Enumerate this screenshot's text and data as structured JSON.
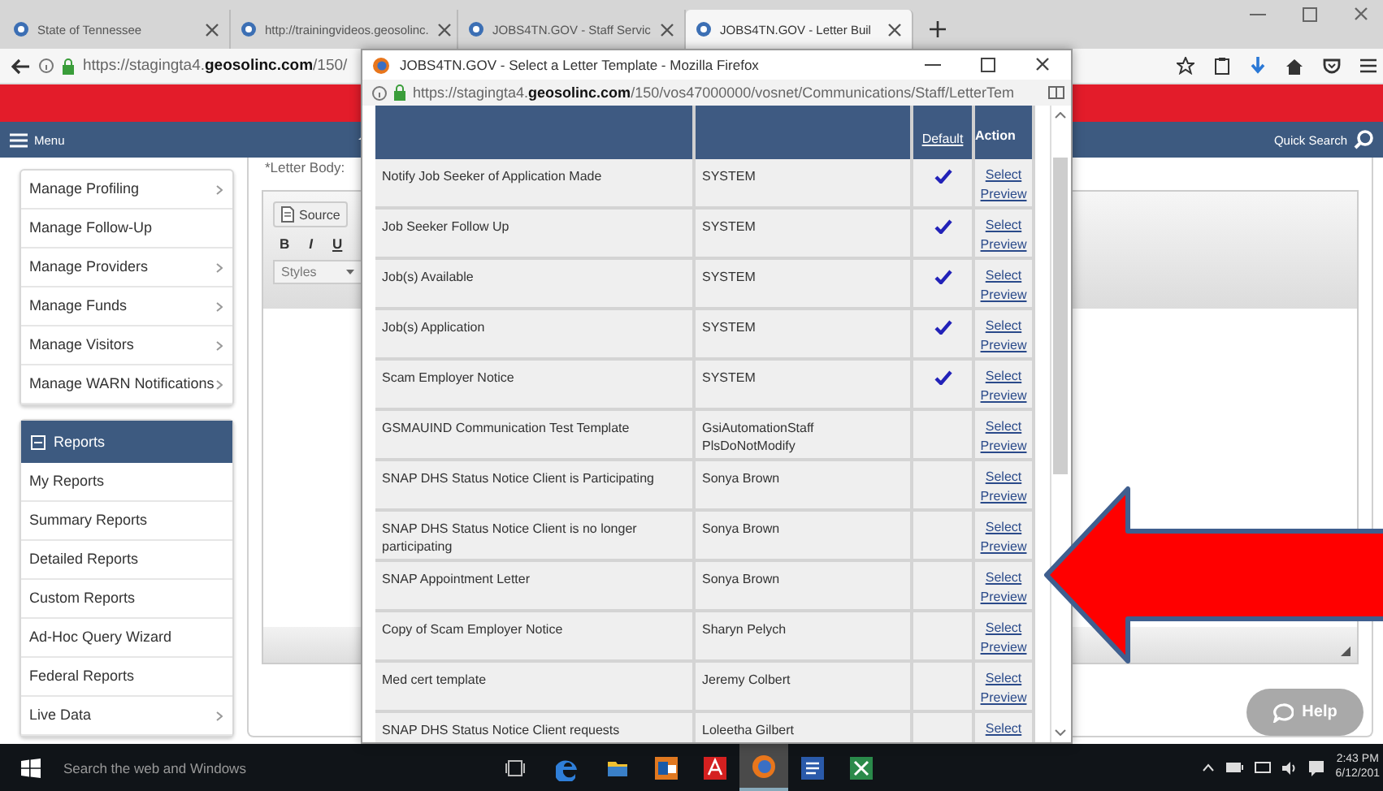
{
  "browser": {
    "tabs": [
      {
        "label": "State of Tennessee",
        "selected": false
      },
      {
        "label": "http://trainingvideos.geosolinc.",
        "selected": false
      },
      {
        "label": "JOBS4TN.GOV - Staff Servic",
        "selected": false
      },
      {
        "label": "JOBS4TN.GOV - Letter Buil",
        "selected": true
      }
    ],
    "url": "https://stagingta4.**geosolinc.com**/150/"
  },
  "nav": {
    "menu": "Menu",
    "quick_search": "Quick Search"
  },
  "sidebar": {
    "groups": [
      {
        "items": [
          {
            "label": "Manage Profiling",
            "has_submenu": true
          },
          {
            "label": "Manage Follow-Up",
            "has_submenu": false
          },
          {
            "label": "Manage Providers",
            "has_submenu": true
          },
          {
            "label": "Manage Funds",
            "has_submenu": true
          },
          {
            "label": "Manage Visitors",
            "has_submenu": true
          },
          {
            "label": "Manage WARN Notifications",
            "has_submenu": true
          }
        ]
      },
      {
        "header": "Reports",
        "items": [
          {
            "label": "My Reports",
            "has_submenu": false
          },
          {
            "label": "Summary Reports",
            "has_submenu": false
          },
          {
            "label": "Detailed Reports",
            "has_submenu": false
          },
          {
            "label": "Custom Reports",
            "has_submenu": false
          },
          {
            "label": "Ad-Hoc Query Wizard",
            "has_submenu": false
          },
          {
            "label": "Federal Reports",
            "has_submenu": false
          },
          {
            "label": "Live Data",
            "has_submenu": true
          }
        ]
      }
    ]
  },
  "editor": {
    "label": "*Letter Body:",
    "source": "Source",
    "format_buttons": [
      "B",
      "I",
      "U"
    ],
    "styles": "Styles"
  },
  "popup": {
    "title": "JOBS4TN.GOV - Select a Letter Template - Mozilla Firefox",
    "url": "https://stagingta4.**geosolinc.com**/150/vos47000000/vosnet/Communications/Staff/LetterTem",
    "columns": [
      {},
      {},
      {
        "heading": "Default"
      },
      {
        "heading": "Action"
      }
    ],
    "rows": [
      {
        "name": "Notify Job Seeker of Application Made",
        "created_by": "SYSTEM",
        "system_default": true,
        "actions": [
          "Select",
          "Preview"
        ]
      },
      {
        "name": "Job Seeker Follow Up",
        "created_by": "SYSTEM",
        "system_default": true,
        "actions": [
          "Select",
          "Preview"
        ]
      },
      {
        "name": "Job(s) Available",
        "created_by": "SYSTEM",
        "system_default": true,
        "actions": [
          "Select",
          "Preview"
        ]
      },
      {
        "name": "Job(s) Application",
        "created_by": "SYSTEM",
        "system_default": true,
        "actions": [
          "Select",
          "Preview"
        ]
      },
      {
        "name": "Scam Employer Notice",
        "created_by": "SYSTEM",
        "system_default": true,
        "actions": [
          "Select",
          "Preview"
        ]
      },
      {
        "name": "GSMAUIND Communication Test Template",
        "created_by": "GsiAutomationStaff PlsDoNotModify",
        "system_default": false,
        "actions": [
          "Select",
          "Preview"
        ]
      },
      {
        "name": "SNAP DHS Status Notice Client is Participating",
        "created_by": "Sonya Brown",
        "system_default": false,
        "actions": [
          "Select",
          "Preview"
        ]
      },
      {
        "name": "SNAP DHS Status Notice Client is no longer participating",
        "created_by": "Sonya Brown",
        "system_default": false,
        "actions": [
          "Select",
          "Preview"
        ]
      },
      {
        "name": "SNAP Appointment Letter",
        "created_by": "Sonya Brown",
        "system_default": false,
        "actions": [
          "Select",
          "Preview"
        ]
      },
      {
        "name": "Copy of Scam Employer Notice",
        "created_by": "Sharyn Pelych",
        "system_default": false,
        "actions": [
          "Select",
          "Preview"
        ]
      },
      {
        "name": "Med cert template",
        "created_by": "Jeremy Colbert",
        "system_default": false,
        "actions": [
          "Select",
          "Preview"
        ]
      },
      {
        "name": "SNAP DHS Status Notice Client requests",
        "created_by": "Loleetha Gilbert",
        "system_default": false,
        "actions": [
          "Select"
        ]
      }
    ]
  },
  "help": "Help",
  "taskbar": {
    "search_placeholder": "Search the web and Windows",
    "apps": [
      {
        "kind": "edge",
        "active": false
      },
      {
        "kind": "explorer",
        "active": false
      },
      {
        "kind": "outlook",
        "active": false
      },
      {
        "kind": "acrobat",
        "active": false
      },
      {
        "kind": "firefox",
        "active": true
      },
      {
        "kind": "word",
        "active": false
      },
      {
        "kind": "excel",
        "active": false
      }
    ],
    "time": "2:43 PM",
    "date": "6/12/201"
  }
}
